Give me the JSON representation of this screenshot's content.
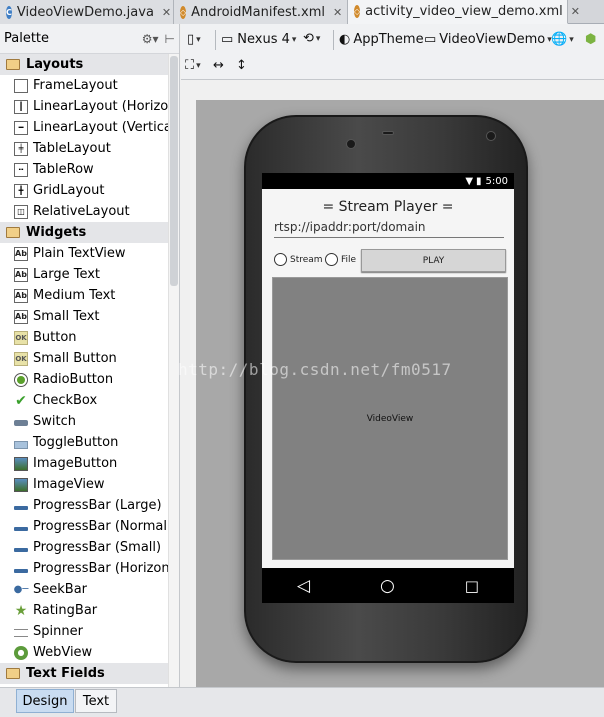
{
  "tabs": [
    {
      "label": "VideoViewDemo.java",
      "icon": "java-class-icon",
      "icon_letter": "C"
    },
    {
      "label": "AndroidManifest.xml",
      "icon": "xml-file-icon"
    },
    {
      "label": "activity_video_view_demo.xml",
      "icon": "xml-file-icon",
      "active": true
    }
  ],
  "palette": {
    "title": "Palette",
    "categories": [
      {
        "label": "Layouts",
        "items": [
          "FrameLayout",
          "LinearLayout (Horizontal)",
          "LinearLayout (Vertical)",
          "TableLayout",
          "TableRow",
          "GridLayout",
          "RelativeLayout"
        ]
      },
      {
        "label": "Widgets",
        "items": [
          "Plain TextView",
          "Large Text",
          "Medium Text",
          "Small Text",
          "Button",
          "Small Button",
          "RadioButton",
          "CheckBox",
          "Switch",
          "ToggleButton",
          "ImageButton",
          "ImageView",
          "ProgressBar (Large)",
          "ProgressBar (Normal)",
          "ProgressBar (Small)",
          "ProgressBar (Horizontal)",
          "SeekBar",
          "RatingBar",
          "Spinner",
          "WebView"
        ]
      },
      {
        "label": "Text Fields",
        "items": []
      }
    ]
  },
  "toolbar": {
    "device": "Nexus 4",
    "theme": "AppTheme",
    "activity": "VideoViewDemo"
  },
  "phone": {
    "time": "5:00",
    "title": "= Stream Player =",
    "url": "rtsp://ipaddr:port/domain",
    "radio_stream": "Stream",
    "radio_file": "File",
    "play": "PLAY",
    "video_label": "VideoView"
  },
  "watermark": "http://blog.csdn.net/fm0517",
  "bottom_tabs": [
    "Design",
    "Text"
  ],
  "colors": {
    "accent": "#c9dcf1",
    "folder": "#f1cf87"
  }
}
